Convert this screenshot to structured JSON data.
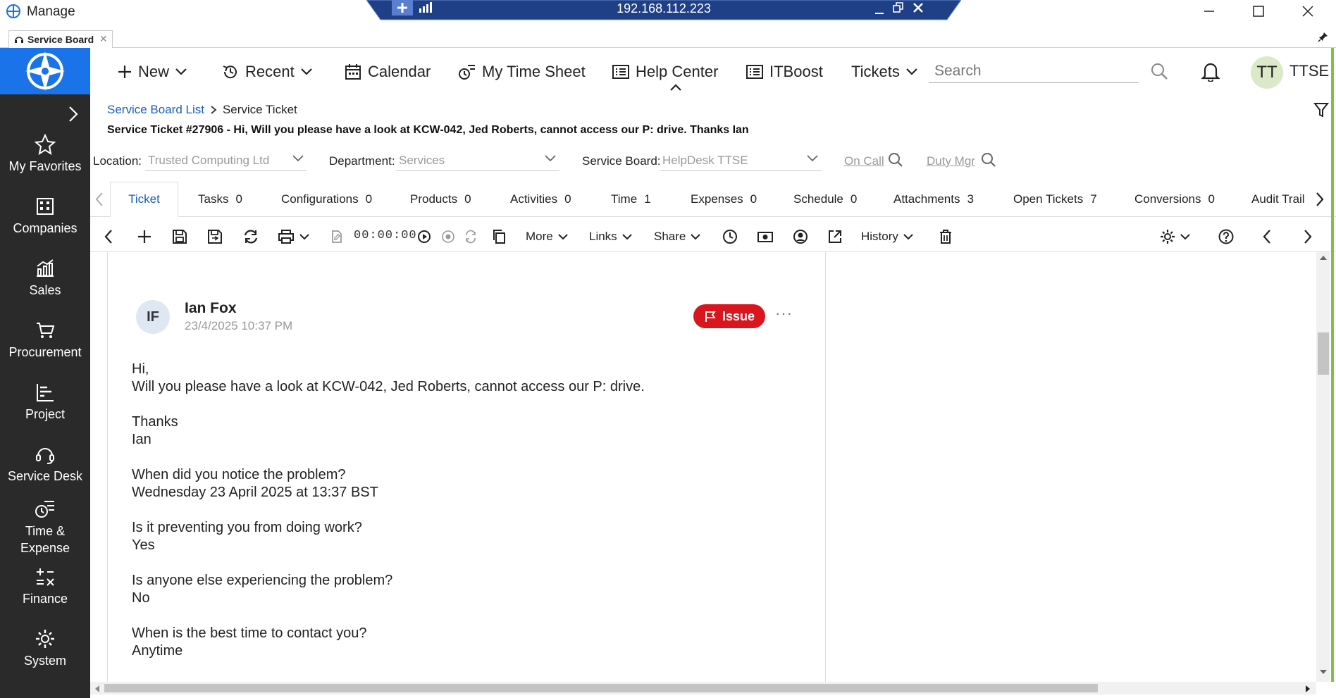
{
  "window": {
    "title": "Manage",
    "remote_ip": "192.168.112.223"
  },
  "browser_tab": {
    "label": "Service Board"
  },
  "sidebar": {
    "items": [
      {
        "label": "My Favorites",
        "icon": "star-icon"
      },
      {
        "label": "Companies",
        "icon": "building-icon"
      },
      {
        "label": "Sales",
        "icon": "chart-icon"
      },
      {
        "label": "Procurement",
        "icon": "cart-icon"
      },
      {
        "label": "Project",
        "icon": "project-icon"
      },
      {
        "label": "Service Desk",
        "icon": "headset-icon"
      },
      {
        "label": "Time &",
        "label2": "Expense",
        "icon": "time-expense-icon"
      },
      {
        "label": "Finance",
        "icon": "finance-icon"
      },
      {
        "label": "System",
        "icon": "gear-icon"
      }
    ]
  },
  "topnav": {
    "new": "New",
    "recent": "Recent",
    "calendar": "Calendar",
    "timesheet": "My Time Sheet",
    "helpcenter": "Help Center",
    "itboost": "ITBoost",
    "tickets": "Tickets",
    "search_placeholder": "Search",
    "avatar_initials": "TT",
    "user": "TTSE"
  },
  "breadcrumb": {
    "parent": "Service Board List",
    "current": "Service Ticket"
  },
  "ticket_title": "Service Ticket #27906 - Hi, Will you please have a look at KCW-042, Jed Roberts, cannot access our P: drive. Thanks Ian",
  "filters": {
    "location_label": "Location:",
    "location_value": "Trusted Computing Ltd",
    "department_label": "Department:",
    "department_value": "Services",
    "board_label": "Service Board:",
    "board_value": "HelpDesk TTSE",
    "on_call": "On Call",
    "duty_mgr": "Duty Mgr"
  },
  "tabs": [
    {
      "label": "Ticket",
      "count": ""
    },
    {
      "label": "Tasks",
      "count": "0"
    },
    {
      "label": "Configurations",
      "count": "0"
    },
    {
      "label": "Products",
      "count": "0"
    },
    {
      "label": "Activities",
      "count": "0"
    },
    {
      "label": "Time",
      "count": "1"
    },
    {
      "label": "Expenses",
      "count": "0"
    },
    {
      "label": "Schedule",
      "count": "0"
    },
    {
      "label": "Attachments",
      "count": "3"
    },
    {
      "label": "Open Tickets",
      "count": "7"
    },
    {
      "label": "Conversions",
      "count": "0"
    },
    {
      "label": "Audit Trail",
      "count": ""
    }
  ],
  "toolbar": {
    "timer": "00:00:00",
    "more": "More",
    "links": "Links",
    "share": "Share",
    "history": "History"
  },
  "message": {
    "initials": "IF",
    "author": "Ian Fox",
    "timestamp": "23/4/2025 10:37 PM",
    "badge": "Issue",
    "more": "···",
    "lines": [
      "Hi,",
      "Will you please have a look at KCW-042, Jed Roberts, cannot access our P: drive.",
      "Thanks",
      "Ian",
      "When did you notice the problem?",
      "Wednesday 23 April 2025 at 13:37 BST",
      "Is it preventing you from doing work?",
      "Yes",
      "Is anyone else experiencing the problem?",
      "No",
      "When is the best time to contact you?",
      "Anytime"
    ]
  },
  "colors": {
    "sidebar": "#2a2a2a",
    "logo_bg": "#1a73e8",
    "link": "#1a5fb4",
    "issue_badge": "#d9151e",
    "remote_bar": "#1f3f86"
  }
}
